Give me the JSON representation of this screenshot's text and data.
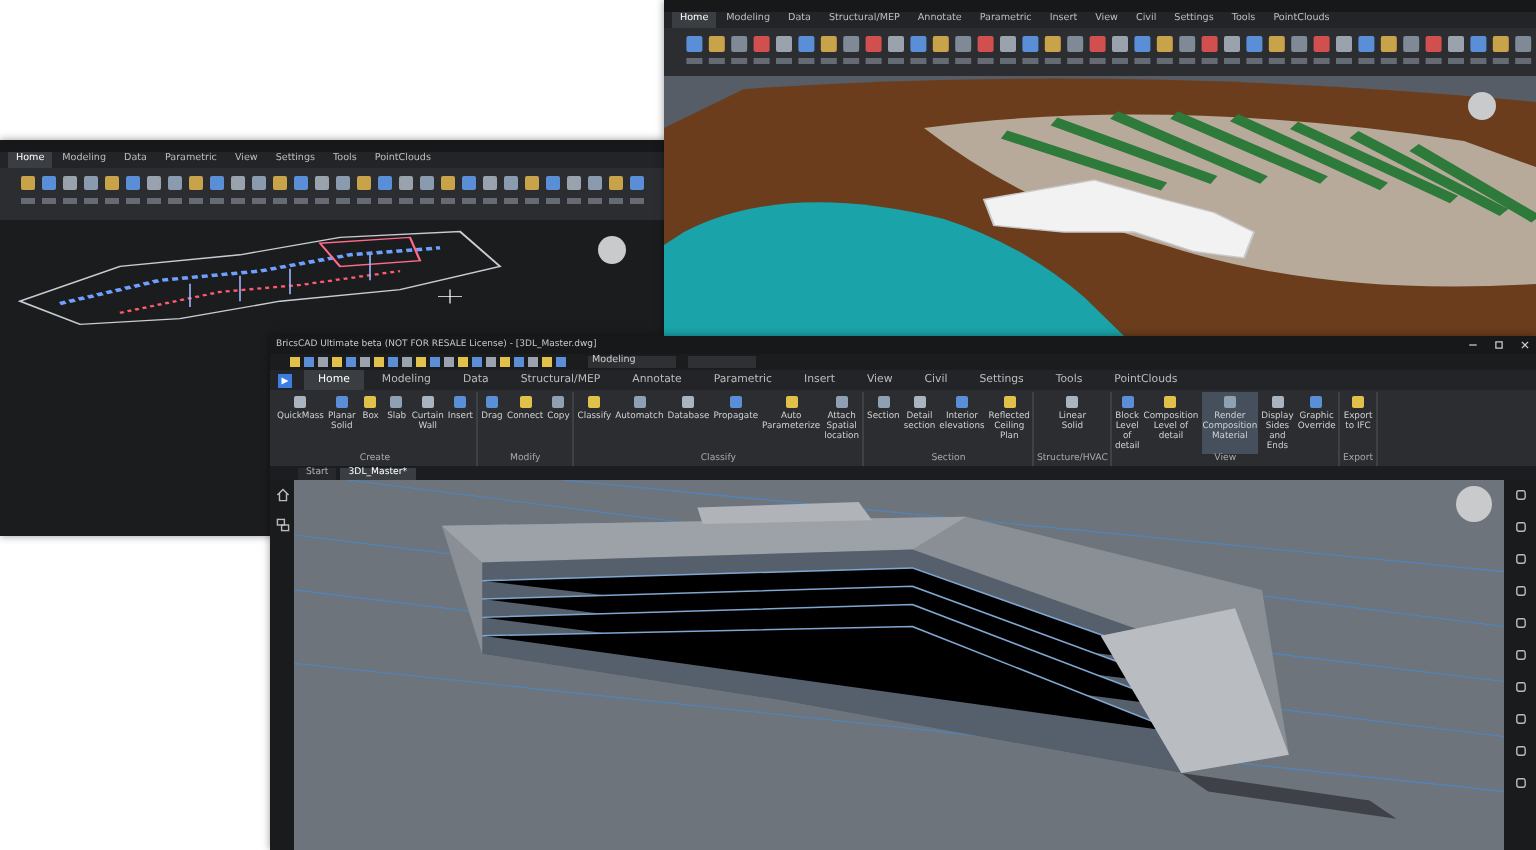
{
  "plan_window": {
    "tabs": [
      {
        "label": "Home",
        "selected": true
      },
      {
        "label": "Modeling",
        "selected": false
      },
      {
        "label": "Data",
        "selected": false
      },
      {
        "label": "Parametric",
        "selected": false
      },
      {
        "label": "View",
        "selected": false
      },
      {
        "label": "Settings",
        "selected": false
      },
      {
        "label": "Tools",
        "selected": false
      },
      {
        "label": "PointClouds",
        "selected": false
      }
    ]
  },
  "site_window": {
    "tabs": [
      {
        "label": "Home",
        "selected": true
      },
      {
        "label": "Modeling",
        "selected": false
      },
      {
        "label": "Data",
        "selected": false
      },
      {
        "label": "Structural/MEP",
        "selected": false
      },
      {
        "label": "Annotate",
        "selected": false
      },
      {
        "label": "Parametric",
        "selected": false
      },
      {
        "label": "Insert",
        "selected": false
      },
      {
        "label": "View",
        "selected": false
      },
      {
        "label": "Civil",
        "selected": false
      },
      {
        "label": "Settings",
        "selected": false
      },
      {
        "label": "Tools",
        "selected": false
      },
      {
        "label": "PointClouds",
        "selected": false
      }
    ]
  },
  "main_window": {
    "title": "BricsCAD Ultimate beta (NOT FOR RESALE License) - [3DL_Master.dwg]",
    "workspace": "Modeling",
    "tabs": [
      {
        "label": "Home",
        "selected": true
      },
      {
        "label": "Modeling",
        "selected": false
      },
      {
        "label": "Data",
        "selected": false
      },
      {
        "label": "Structural/MEP",
        "selected": false
      },
      {
        "label": "Annotate",
        "selected": false
      },
      {
        "label": "Parametric",
        "selected": false
      },
      {
        "label": "Insert",
        "selected": false
      },
      {
        "label": "View",
        "selected": false
      },
      {
        "label": "Civil",
        "selected": false
      },
      {
        "label": "Settings",
        "selected": false
      },
      {
        "label": "Tools",
        "selected": false
      },
      {
        "label": "PointClouds",
        "selected": false
      }
    ],
    "ribbon_groups": [
      {
        "label": "Create",
        "buttons": [
          {
            "label": "QuickMass",
            "selected": false
          },
          {
            "label": "Planar Solid",
            "selected": false
          },
          {
            "label": "Box",
            "selected": false
          },
          {
            "label": "Slab",
            "selected": false
          },
          {
            "label": "Curtain Wall",
            "selected": false
          },
          {
            "label": "Insert",
            "selected": false
          }
        ]
      },
      {
        "label": "Modify",
        "buttons": [
          {
            "label": "Drag",
            "selected": false
          },
          {
            "label": "Connect",
            "selected": false
          },
          {
            "label": "Copy",
            "selected": false
          }
        ]
      },
      {
        "label": "Classify",
        "buttons": [
          {
            "label": "Classify",
            "selected": false
          },
          {
            "label": "Automatch",
            "selected": false
          },
          {
            "label": "Database",
            "selected": false
          },
          {
            "label": "Propagate",
            "selected": false
          },
          {
            "label": "Auto Parameterize",
            "selected": false
          },
          {
            "label": "Attach Spatial location",
            "selected": false
          }
        ]
      },
      {
        "label": "Section",
        "buttons": [
          {
            "label": "Section",
            "selected": false
          },
          {
            "label": "Detail section",
            "selected": false
          },
          {
            "label": "Interior elevations",
            "selected": false
          },
          {
            "label": "Reflected Ceiling Plan",
            "selected": false
          }
        ]
      },
      {
        "label": "Structure/HVAC",
        "buttons": [
          {
            "label": "Linear Solid",
            "selected": false
          }
        ]
      },
      {
        "label": "View",
        "buttons": [
          {
            "label": "Block Level of detail",
            "selected": false
          },
          {
            "label": "Composition Level of detail",
            "selected": false
          },
          {
            "label": "Render Composition Material",
            "selected": true
          },
          {
            "label": "Display Sides and Ends",
            "selected": false
          },
          {
            "label": "Graphic Override",
            "selected": false
          }
        ]
      },
      {
        "label": "Export",
        "buttons": [
          {
            "label": "Export to IFC",
            "selected": false
          }
        ]
      }
    ],
    "document_tabs": [
      {
        "label": "Start",
        "selected": false
      },
      {
        "label": "3DL_Master*",
        "selected": true
      }
    ]
  }
}
